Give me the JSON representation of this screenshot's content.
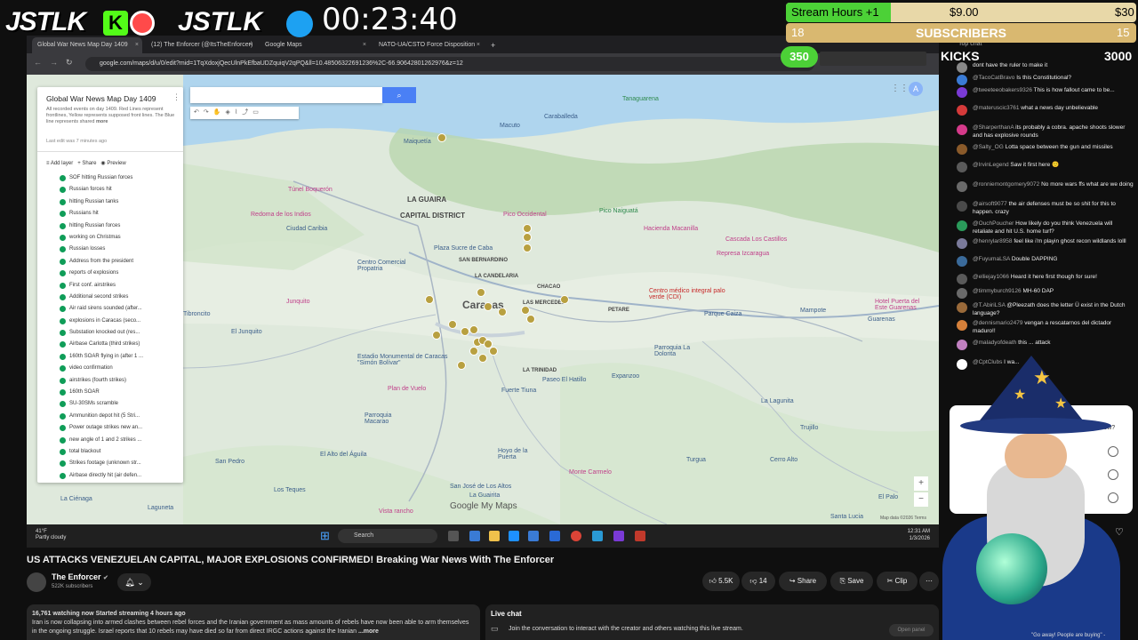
{
  "overlay": {
    "logo_left": "JSTLK",
    "logo_kick": "K",
    "logo_right": "JSTLK",
    "timer": "00:23:40",
    "stream_hours_label": "Stream Hours +1",
    "stream_hours_value": "$9.00",
    "stream_hours_goal": "$30",
    "subs_left": "18",
    "subs_label": "SUBSCRIBERS",
    "subs_right": "15",
    "kicks_count": "350",
    "kicks_label": "KICKS",
    "kicks_goal": "3000"
  },
  "browser": {
    "tabs": [
      {
        "label": "Global War News Map Day 1409",
        "active": true
      },
      {
        "label": "(12) The Enforcer (@ItsTheEnforcer)",
        "active": false
      },
      {
        "label": "Google Maps",
        "active": false
      },
      {
        "label": "NATO-UA/CSTO Force Disposition",
        "active": false
      }
    ],
    "new_tab": "+",
    "url": "google.com/maps/d/u/0/edit?mid=1TqXdoxjQecUlnPkEfbaUDZquiqV2qPQ&ll=10.48506322691236%2C-66.90642801262976&z=12"
  },
  "map": {
    "panel": {
      "title": "Global War News Map Day 1409",
      "description": "All recorded events on day 1409. Red Lines represent frontlines, Yellow represents supposed front lines. The Blue line represents shared",
      "more": "more",
      "last_edit": "Last edit was 7 minutes ago",
      "add_layer": "Add layer",
      "share": "Share",
      "preview": "Preview",
      "items": [
        "SOF hitting Russian forces",
        "Russian forces hit",
        "hitting Russian tanks",
        "Russians hit",
        "hitting Russian forces",
        "working on Christmas",
        "Russian losses",
        "Address from the president",
        "reports of explosions",
        "First conf. airstrikes",
        "Additional second strikes",
        "Air raid sirens sounded (after...",
        "explosions in Caracas (seco...",
        "Substation knocked out (res...",
        "Airbase Carlotta (third strikes)",
        "160th SOAR flying in (after 1 ...",
        "video confirmation",
        "airstrikes (fourth strikes)",
        "160th SOAR",
        "SU-30SMs scramble",
        "Ammunition depot hit (5 Stri...",
        "Power outage strikes new an...",
        "new angle of 1 and 2 strikes ...",
        "total blackout",
        "Strikes footage (unknown str...",
        "Airbase directly hit (air defen..."
      ]
    },
    "places": {
      "caraballeda": "Caraballeda",
      "macuto": "Macuto",
      "maiquetia": "Maiquetía",
      "tanaguarena": "Tanaguarena",
      "la_guaira": "LA GUAIRA",
      "capital_district": "CAPITAL DISTRICT",
      "ciudad_caribia": "Ciudad Caribia",
      "caracas": "Caracas",
      "chacao": "CHACAO",
      "petare": "PETARE",
      "las_mercedes": "LAS MERCEDES",
      "la_candelaria": "LA CANDELARIA",
      "san_bernardino": "SAN BERNARDINO",
      "el_junquito": "El Junquito",
      "la_trinidad": "LA TRINIDAD",
      "parroquia_la_dolorita": "Parroquia La Dolorita",
      "la_lagunita": "La Lagunita",
      "trujillo": "Trujillo",
      "turgua": "Turgua",
      "san_pedro": "San Pedro",
      "los_teques": "Los Teques",
      "la_guairita": "La Guairita",
      "hoyo_de_la_puerta": "Hoyo de la Puerta",
      "san_jose_de_los_altos": "San José de Los Altos",
      "guarenas": "Guarenas",
      "mampote": "Mampote",
      "pico_occidental": "Pico Occidental",
      "pico_naiguata": "Pico Naiguatá",
      "hacienda": "Hacienda Macanilla",
      "cascada": "Cascada Los Castillos",
      "represa": "Represa Izcaragua",
      "parque_caiza": "Parque Caiza",
      "expanzoo": "Expanzoo",
      "paseo_hatillo": "Paseo El Hatillo",
      "plan_vuelo": "Plan de Vuelo",
      "monte_carmelo": "Monte Carmelo",
      "estadio": "Estadio Monumental de Caracas \"Simón Bolívar\"",
      "centro_medico": "Centro médico integral palo verde (CDI)",
      "hotel": "Hotel Puerta del Este Guarenas",
      "tunel": "Túnel Boquerón",
      "redoma": "Redoma de los Indios",
      "plaza_sucre": "Plaza Sucre de Caba",
      "centro_comercial": "Centro Comercial Propatria",
      "junquito": "Junquito",
      "tibronito": "Tibroncito",
      "fuerte": "Fuerte Tiuna",
      "el_palo": "El Palo",
      "santa_lucia": "Santa Lucia",
      "laguneta": "Laguneta",
      "la_cienaga": "La Ciénaga",
      "macarao": "Parroquia Macarao",
      "altos_aguila": "El Alto del Águila",
      "cerro_alto": "Cerro Alto",
      "vista_rancho": "Vista rancho"
    },
    "google_logo": "Google My Maps",
    "attribution": "Map data ©2026  Terms"
  },
  "taskbar": {
    "temp": "41°F",
    "weather": "Partly cloudy",
    "search": "Search",
    "time": "12:31 AM",
    "date": "1/3/2026"
  },
  "video": {
    "title": "US ATTACKS VENEZUELAN CAPITAL, MAJOR EXPLOSIONS CONFIRMED! Breaking War News With The Enforcer",
    "channel": "The Enforcer",
    "subscribers": "522K subscribers",
    "likes": "5.5K",
    "dislikes": "14",
    "share": "Share",
    "save": "Save",
    "clip": "Clip",
    "stats": "16,761 watching now  Started streaming 4 hours ago",
    "description": "Iran is now collapsing into armed clashes between rebel forces and the Iranian government as mass amounts of rebels have now been able to arm themselves in the ongoing struggle. Israel reports that 10 rebels may have died so far from direct IRGC actions against the Iranian",
    "more": "...more",
    "live_chat_title": "Live chat",
    "live_chat_text": "Join the conversation to interact with the creator and others watching this live stream.",
    "open_panel": "Open panel"
  },
  "chat": {
    "top_chat": "Top chat",
    "messages": [
      {
        "user": "",
        "text": "dont have the ruler to make it",
        "color": "#888888"
      },
      {
        "user": "@TacoCatBravo",
        "text": "Is this Constitutional?",
        "color": "#3a7bd5"
      },
      {
        "user": "@tweeteeobakers9326",
        "text": "This is how fallout came to be...",
        "color": "#7a3ad5"
      },
      {
        "user": "@materuscic3761",
        "text": "what a news day unbelievable",
        "color": "#d53a3a"
      },
      {
        "user": "@SharperthanA",
        "text": "its probably a cobra. apache shoots slower and has explosive rounds",
        "color": "#d53a8a"
      },
      {
        "user": "@Salty_OG",
        "text": "Lotta space between the gun and missiles",
        "color": "#8a5a2a"
      },
      {
        "user": "@IrvinLegend",
        "text": "Saw it first here 🙂",
        "color": "#5a5a5a"
      },
      {
        "user": "@ronniemontgomery9072",
        "text": "No more wars ffs what are we doing",
        "color": "#6a6a6a"
      },
      {
        "user": "@airsoft9077",
        "text": "the air defenses must be so shit for this to happen. crazy",
        "color": "#4a4a4a"
      },
      {
        "user": "@OuchPoucher",
        "text": "How likely do you think Venezuela will retaliate and hit U.S. home turf?",
        "color": "#2a9a5a"
      },
      {
        "user": "@henrylar8958",
        "text": "feel like i'm playin ghost recon wildlands lolll",
        "color": "#7a7a9a"
      },
      {
        "user": "@FuyumaLSA",
        "text": "Double DAPPING",
        "color": "#3a6a9a"
      },
      {
        "user": "@elliejay1066",
        "text": "Heard it here first though for sure!",
        "color": "#5a5a5a"
      },
      {
        "user": "@timmyburch9126",
        "text": "MH-60 DAP",
        "color": "#6a6a6a"
      },
      {
        "user": "@T.AbiriLSA",
        "text": "@Pleezath does the letter Ü exist in the Dutch language?",
        "color": "#9a6a3a"
      },
      {
        "user": "@dennismario2479",
        "text": "vengan a rescatarnos del dictador maduro!!",
        "color": "#d5803a"
      },
      {
        "user": "@maladyofdeath",
        "text": "this ... attack",
        "color": "#c080c0"
      },
      {
        "user": "@CptClubs",
        "text": "I wa...",
        "color": "#ffffff"
      }
    ],
    "poll_question": "Right Now?",
    "bottom_msg": "\"Go away! People are buying\" -"
  }
}
